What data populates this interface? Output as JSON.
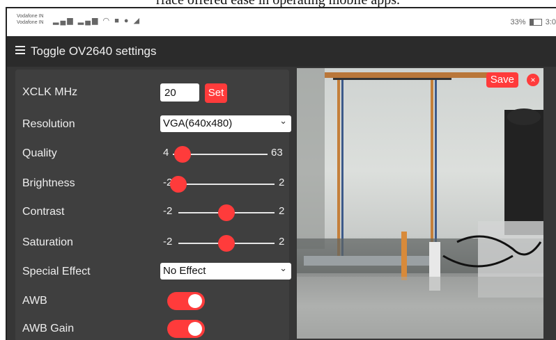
{
  "caption": "rface offered ease in operating mobile apps.",
  "status_bar": {
    "carrier_1": "Vodafone IN",
    "carrier_2": "Vodafone IN",
    "battery": "33%",
    "time": "3:0"
  },
  "header": {
    "toggle_label": "Toggle OV2640 settings"
  },
  "settings": {
    "xclk": {
      "label": "XCLK MHz",
      "value": "20",
      "button": "Set"
    },
    "resolution": {
      "label": "Resolution",
      "selected": "VGA(640x480)"
    },
    "quality": {
      "label": "Quality",
      "min": "4",
      "max": "63",
      "level": 0.1
    },
    "brightness": {
      "label": "Brightness",
      "min": "-2",
      "max": "2",
      "level": 0.0
    },
    "contrast": {
      "label": "Contrast",
      "min": "-2",
      "max": "2",
      "level": 0.5
    },
    "saturation": {
      "label": "Saturation",
      "min": "-2",
      "max": "2",
      "level": 0.5
    },
    "special_effect": {
      "label": "Special Effect",
      "selected": "No Effect"
    },
    "awb": {
      "label": "AWB",
      "on": true
    },
    "awb_gain": {
      "label": "AWB Gain",
      "on": true
    }
  },
  "stream": {
    "save": "Save",
    "close": "×"
  },
  "colors": {
    "accent": "#ff3b3b",
    "panel": "#3f3f3f",
    "background": "#363636"
  }
}
